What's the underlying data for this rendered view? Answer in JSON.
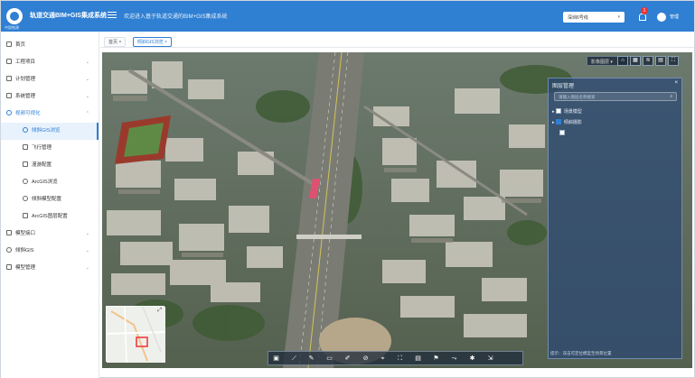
{
  "header": {
    "logo_text": "中国铁建",
    "system_title": "轨道交通BIM+GIS集成系统",
    "welcome": "欢迎进入基于轨道交通的BIM+GIS集成系统",
    "line_select": "深圳6号线",
    "notification_count": "1",
    "username": "管理"
  },
  "sidebar": {
    "items": [
      {
        "label": "首页",
        "icon": "home-icon"
      },
      {
        "label": "工程项目",
        "icon": "folder-icon"
      },
      {
        "label": "计划管理",
        "icon": "chart-icon"
      },
      {
        "label": "系统管理",
        "icon": "settings-icon"
      },
      {
        "label": "视频可视化",
        "icon": "globe-icon"
      }
    ],
    "subitems": [
      {
        "label": "倾斜GIS浏览",
        "icon": "target-icon"
      },
      {
        "label": "飞行管理",
        "icon": "flight-icon"
      },
      {
        "label": "漫游配置",
        "icon": "camera-icon"
      },
      {
        "label": "ArcGIS浏览",
        "icon": "layers-icon"
      },
      {
        "label": "倾斜模型配置",
        "icon": "refresh-icon"
      },
      {
        "label": "ArcGIS图层配置",
        "icon": "list-icon"
      }
    ],
    "bottom_items": [
      {
        "label": "模型接口",
        "icon": "link-icon"
      },
      {
        "label": "倾斜GIS",
        "icon": "globe-icon"
      },
      {
        "label": "模型管理",
        "icon": "grid-icon"
      }
    ]
  },
  "tabs": [
    {
      "label": "首页",
      "active": false
    },
    {
      "label": "倾斜GIS浏览",
      "active": true
    }
  ],
  "map": {
    "base_dropdown": "影像图层",
    "layer_panel": {
      "title": "图层管理",
      "search_placeholder": "请输入图层名称搜索",
      "tree": [
        {
          "label": "场景模型",
          "checked": false
        },
        {
          "label": "倾斜摄影",
          "checked": true
        },
        {
          "label": "",
          "checked": false
        }
      ],
      "hint": "提示：双击可定位模型至场景位置"
    }
  },
  "colors": {
    "header_bg": "#2f7fd3",
    "accent": "#2f7fd3",
    "badge": "#e33333"
  }
}
